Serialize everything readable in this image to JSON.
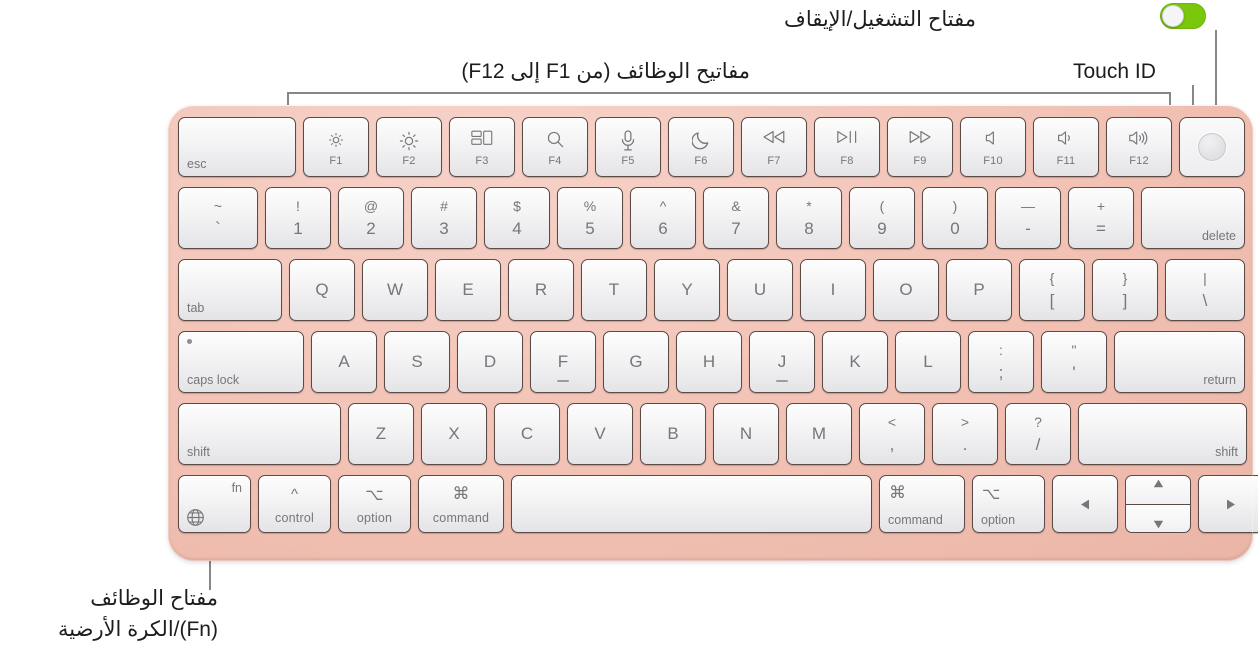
{
  "callouts": {
    "power": {
      "text": "مفتاح التشغيل/الإيقاف"
    },
    "touch_id": {
      "text": "Touch ID"
    },
    "function_keys": {
      "text": "مفاتيح الوظائف (من F1 إلى F12)"
    },
    "fn_globe_line1": {
      "text": "مفتاح الوظائف"
    },
    "fn_globe_line2": {
      "text": "(Fn)/الكرة الأرضية"
    }
  },
  "colors": {
    "keyboard_body": "#f2c2b5",
    "key_face": "#f4f4f5",
    "key_border": "#5a4b47",
    "legend": "#76767b",
    "toggle_on": "#7ac70c",
    "leader_line": "#86868b"
  },
  "toggle": {
    "state": "on"
  },
  "keyboard": {
    "rows": {
      "function_row": [
        {
          "name": "esc",
          "label": "esc",
          "style": "bottom-left"
        },
        {
          "name": "f1",
          "fn": "F1",
          "icon": "brightness-down-icon"
        },
        {
          "name": "f2",
          "fn": "F2",
          "icon": "brightness-up-icon"
        },
        {
          "name": "f3",
          "fn": "F3",
          "icon": "mission-control-icon"
        },
        {
          "name": "f4",
          "fn": "F4",
          "icon": "spotlight-search-icon"
        },
        {
          "name": "f5",
          "fn": "F5",
          "icon": "dictation-microphone-icon"
        },
        {
          "name": "f6",
          "fn": "F6",
          "icon": "do-not-disturb-moon-icon"
        },
        {
          "name": "f7",
          "fn": "F7",
          "icon": "rewind-icon"
        },
        {
          "name": "f8",
          "fn": "F8",
          "icon": "play-pause-icon"
        },
        {
          "name": "f9",
          "fn": "F9",
          "icon": "fast-forward-icon"
        },
        {
          "name": "f10",
          "fn": "F10",
          "icon": "mute-icon"
        },
        {
          "name": "f11",
          "fn": "F11",
          "icon": "volume-down-icon"
        },
        {
          "name": "f12",
          "fn": "F12",
          "icon": "volume-up-icon"
        },
        {
          "name": "touch-id",
          "icon": "touch-id-icon"
        }
      ],
      "number_row": [
        {
          "name": "backtick",
          "top": "~",
          "bot": "`"
        },
        {
          "name": "one",
          "top": "!",
          "bot": "1"
        },
        {
          "name": "two",
          "top": "@",
          "bot": "2"
        },
        {
          "name": "three",
          "top": "#",
          "bot": "3"
        },
        {
          "name": "four",
          "top": "$",
          "bot": "4"
        },
        {
          "name": "five",
          "top": "%",
          "bot": "5"
        },
        {
          "name": "six",
          "top": "^",
          "bot": "6"
        },
        {
          "name": "seven",
          "top": "&",
          "bot": "7"
        },
        {
          "name": "eight",
          "top": "*",
          "bot": "8"
        },
        {
          "name": "nine",
          "top": "(",
          "bot": "9"
        },
        {
          "name": "zero",
          "top": ")",
          "bot": "0"
        },
        {
          "name": "minus",
          "top": "—",
          "bot": "-"
        },
        {
          "name": "equal",
          "top": "+",
          "bot": "="
        },
        {
          "name": "delete",
          "label": "delete",
          "style": "bottom-right"
        }
      ],
      "top_letter_row": [
        {
          "name": "tab",
          "label": "tab",
          "style": "bottom-left"
        },
        {
          "name": "q",
          "label": "Q"
        },
        {
          "name": "w",
          "label": "W"
        },
        {
          "name": "e",
          "label": "E"
        },
        {
          "name": "r",
          "label": "R"
        },
        {
          "name": "t",
          "label": "T"
        },
        {
          "name": "y",
          "label": "Y"
        },
        {
          "name": "u",
          "label": "U"
        },
        {
          "name": "i",
          "label": "I"
        },
        {
          "name": "o",
          "label": "O"
        },
        {
          "name": "p",
          "label": "P"
        },
        {
          "name": "left-bracket",
          "top": "{",
          "bot": "["
        },
        {
          "name": "right-bracket",
          "top": "}",
          "bot": "]"
        },
        {
          "name": "backslash",
          "top": "|",
          "bot": "\\"
        }
      ],
      "home_row": [
        {
          "name": "caps-lock",
          "label": "caps lock",
          "style": "bottom-left",
          "led": true
        },
        {
          "name": "a",
          "label": "A"
        },
        {
          "name": "s",
          "label": "S"
        },
        {
          "name": "d",
          "label": "D"
        },
        {
          "name": "f",
          "label": "F",
          "homing": true
        },
        {
          "name": "g",
          "label": "G"
        },
        {
          "name": "h",
          "label": "H"
        },
        {
          "name": "j",
          "label": "J",
          "homing": true
        },
        {
          "name": "k",
          "label": "K"
        },
        {
          "name": "l",
          "label": "L"
        },
        {
          "name": "semicolon",
          "top": ":",
          "bot": ";"
        },
        {
          "name": "quote",
          "top": "\"",
          "bot": "'"
        },
        {
          "name": "return",
          "label": "return",
          "style": "bottom-right"
        }
      ],
      "shift_row": [
        {
          "name": "left-shift",
          "label": "shift",
          "style": "bottom-left"
        },
        {
          "name": "z",
          "label": "Z"
        },
        {
          "name": "x",
          "label": "X"
        },
        {
          "name": "c",
          "label": "C"
        },
        {
          "name": "v",
          "label": "V"
        },
        {
          "name": "b",
          "label": "B"
        },
        {
          "name": "n",
          "label": "N"
        },
        {
          "name": "m",
          "label": "M"
        },
        {
          "name": "comma",
          "top": "<",
          "bot": ","
        },
        {
          "name": "period",
          "top": ">",
          "bot": "."
        },
        {
          "name": "slash",
          "top": "?",
          "bot": "/"
        },
        {
          "name": "right-shift",
          "label": "shift",
          "style": "bottom-right"
        }
      ],
      "bottom_row": [
        {
          "name": "fn-globe",
          "fnLabel": "fn",
          "icon": "globe-icon"
        },
        {
          "name": "left-control",
          "label": "control",
          "modifier": "^"
        },
        {
          "name": "left-option",
          "label": "option",
          "modifier": "⌥"
        },
        {
          "name": "left-command",
          "label": "command",
          "modifier": "⌘"
        },
        {
          "name": "space",
          "label": ""
        },
        {
          "name": "right-command",
          "label": "command",
          "modifier": "⌘",
          "align": "left"
        },
        {
          "name": "right-option",
          "label": "option",
          "modifier": "⌥",
          "align": "left"
        },
        {
          "name": "arrow-left",
          "icon": "arrow-left-icon"
        },
        {
          "name": "arrow-up-down",
          "icon": "arrow-up-down-icon"
        },
        {
          "name": "arrow-right",
          "icon": "arrow-right-icon"
        }
      ]
    }
  }
}
